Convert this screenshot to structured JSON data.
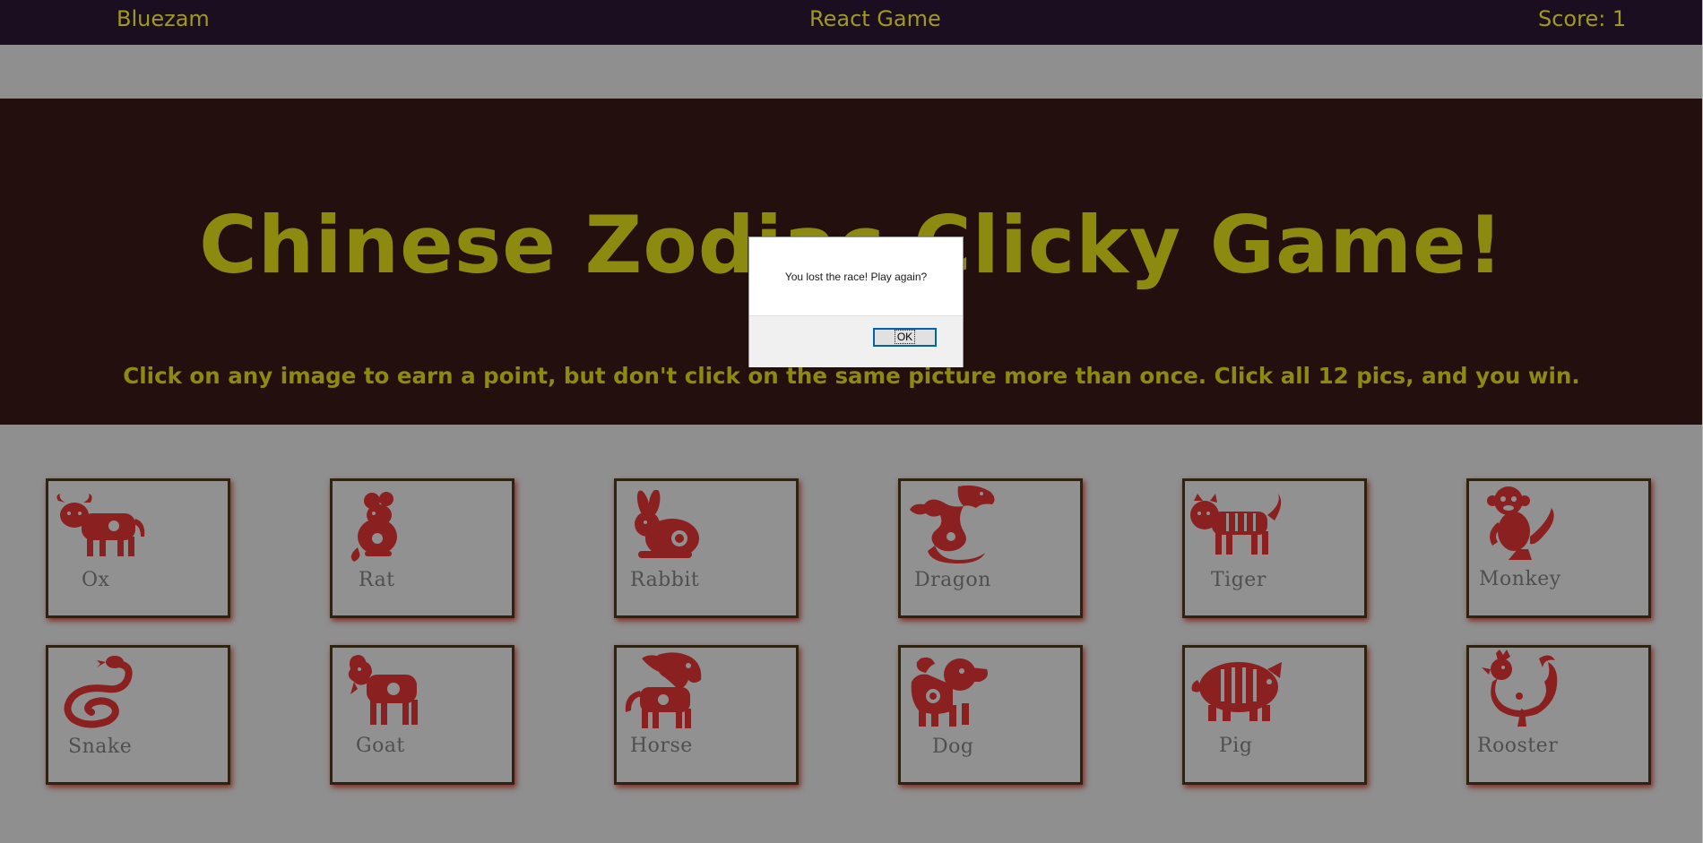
{
  "navbar": {
    "brand": "Bluezam",
    "title": "React Game",
    "score": "Score: 1"
  },
  "hero": {
    "title": "Chinese Zodiac Clicky Game!",
    "subtitle": "Click on any image to earn a point, but don't click on the same picture more than once. Click all 12 pics, and you win."
  },
  "cards": [
    {
      "label": "Ox",
      "icon": "ox-icon"
    },
    {
      "label": "Rat",
      "icon": "rat-icon"
    },
    {
      "label": "Rabbit",
      "icon": "rabbit-icon"
    },
    {
      "label": "Dragon",
      "icon": "dragon-icon"
    },
    {
      "label": "Tiger",
      "icon": "tiger-icon"
    },
    {
      "label": "Monkey",
      "icon": "monkey-icon"
    },
    {
      "label": "Snake",
      "icon": "snake-icon"
    },
    {
      "label": "Goat",
      "icon": "goat-icon"
    },
    {
      "label": "Horse",
      "icon": "horse-icon"
    },
    {
      "label": "Dog",
      "icon": "dog-icon"
    },
    {
      "label": "Pig",
      "icon": "pig-icon"
    },
    {
      "label": "Rooster",
      "icon": "rooster-icon"
    }
  ],
  "dialog": {
    "message": "You lost the race! Play again?",
    "ok_label": "OK"
  },
  "colors": {
    "navbar_bg": "#1b0e20",
    "accent_text": "#a09a1c",
    "hero_bg": "#220f0e",
    "hero_text": "#8c8b10",
    "page_bg": "#8f8f8f",
    "papercut_red": "#8b2020"
  }
}
